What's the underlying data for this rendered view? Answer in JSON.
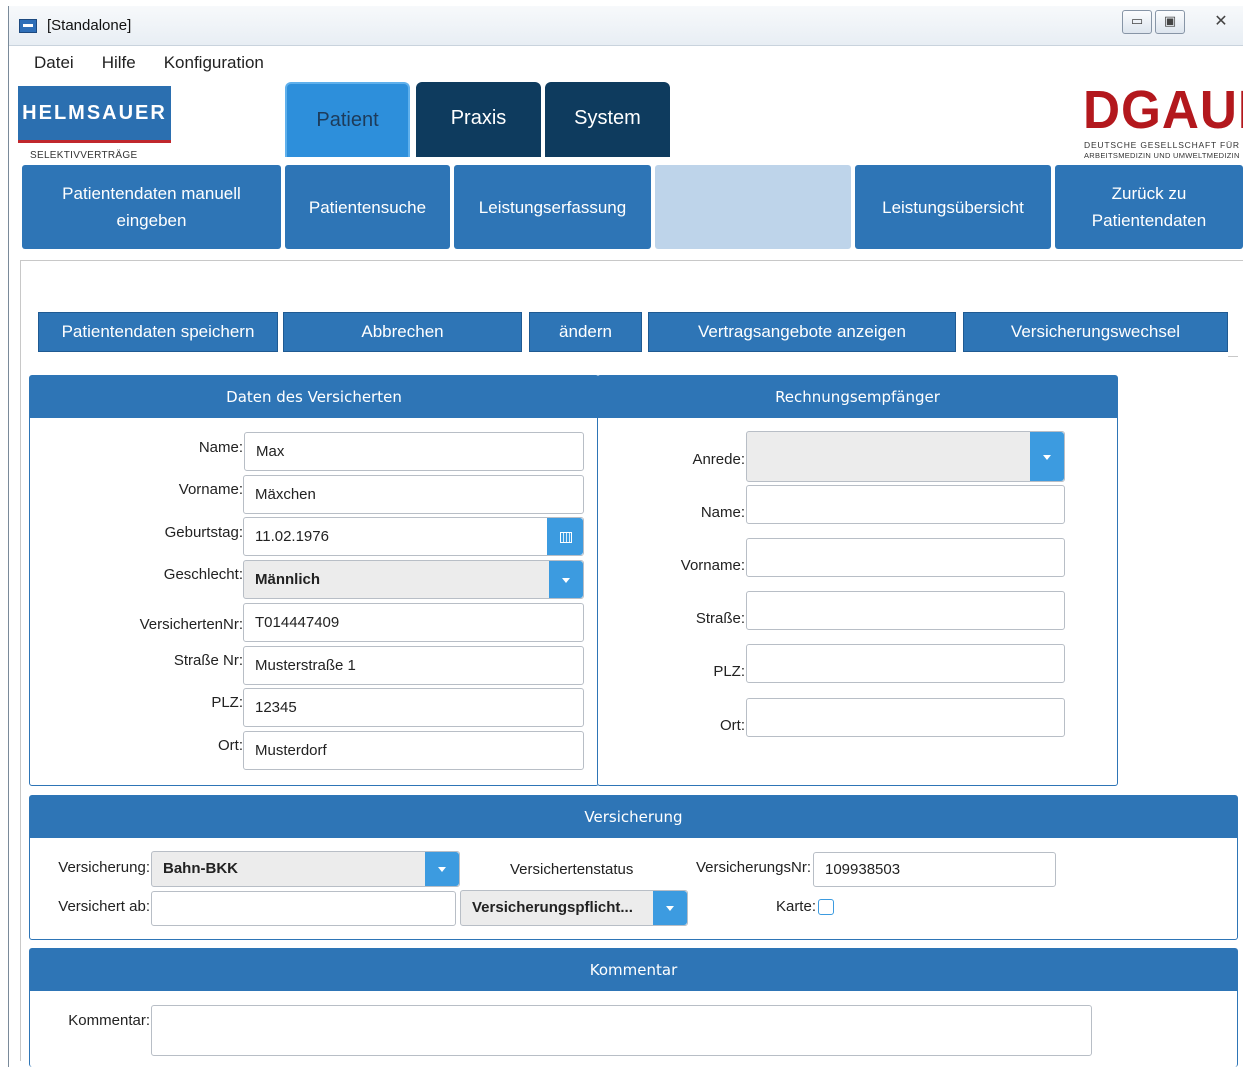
{
  "window": {
    "title": "[Standalone]"
  },
  "menu": [
    "Datei",
    "Hilfe",
    "Konfiguration"
  ],
  "logo_left": {
    "name": "HELMSAUER",
    "sub": "SELEKTIVVERTRÄGE"
  },
  "logo_right": {
    "name": "DGAUM",
    "sub1": "DEUTSCHE GESELLSCHAFT FÜR",
    "sub2": "ARBEITSMEDIZIN UND UMWELTMEDIZIN"
  },
  "main_tabs": [
    {
      "label": "Patient",
      "active": true
    },
    {
      "label": "Praxis",
      "active": false
    },
    {
      "label": "System",
      "active": false
    }
  ],
  "sub_nav": {
    "manual": [
      "Patientendaten manuell",
      "eingeben"
    ],
    "search": "Patientensuche",
    "services": "Leistungserfassung",
    "overview": "Leistungsübersicht",
    "back": [
      "Zurück zu",
      "Patientendaten"
    ]
  },
  "actions": {
    "save": "Patientendaten speichern",
    "cancel": "Abbrechen",
    "change": "ändern",
    "offers": "Vertragsangebote anzeigen",
    "switch": "Versicherungswechsel"
  },
  "insured": {
    "header": "Daten des Versicherten",
    "name_label": "Name:",
    "name": "Max",
    "firstname_label": "Vorname:",
    "firstname": "Mäxchen",
    "birthday_label": "Geburtstag:",
    "birthday": "11.02.1976",
    "gender_label": "Geschlecht:",
    "gender": "Männlich",
    "insnr_label": "VersichertenNr:",
    "insnr": "T014447409",
    "street_label": "Straße Nr:",
    "street": "Musterstraße 1",
    "zip_label": "PLZ:",
    "zip": "12345",
    "city_label": "Ort:",
    "city": "Musterdorf"
  },
  "billing": {
    "header": "Rechnungsempfänger",
    "salutation_label": "Anrede:",
    "salutation": "",
    "name_label": "Name:",
    "name": "",
    "firstname_label": "Vorname:",
    "firstname": "",
    "street_label": "Straße:",
    "street": "",
    "zip_label": "PLZ:",
    "zip": "",
    "city_label": "Ort:",
    "city": ""
  },
  "insurance": {
    "header": "Versicherung",
    "insurer_label": "Versicherung:",
    "insurer": "Bahn-BKK",
    "status_label": "Versichertenstatus",
    "number_label": "VersicherungsNr:",
    "number": "109938503",
    "since_label": "Versichert ab:",
    "since": "",
    "status_value": "Versicherungspflicht...",
    "card_label": "Karte:",
    "card_checked": false
  },
  "comment": {
    "header": "Kommentar",
    "label": "Kommentar:",
    "value": ""
  },
  "colors": {
    "accent": "#2e75b6",
    "tab_active": "#2d8fdb",
    "tab_dark": "#0e3b5e",
    "dropdown": "#3c9be0",
    "dgaum_red": "#b3181d"
  }
}
